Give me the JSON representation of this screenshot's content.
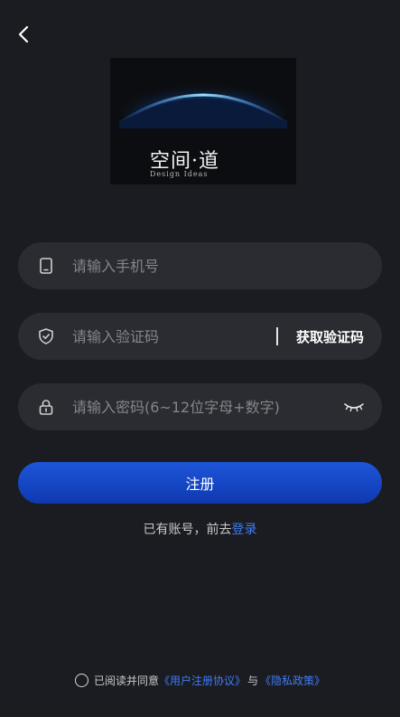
{
  "logo": {
    "text": "空间·道",
    "subtitle": "Design Ideas"
  },
  "icons": {
    "back": "chevron-left-icon",
    "phone": "phone-icon",
    "shield": "shield-check-icon",
    "lock": "lock-icon",
    "eye": "eye-closed-icon"
  },
  "form": {
    "phone_placeholder": "请输入手机号",
    "code_placeholder": "请输入验证码",
    "get_code_label": "获取验证码",
    "password_placeholder": "请输入密码(6~12位字母+数字)"
  },
  "register_button": "注册",
  "login_prompt": {
    "prefix": "已有账号，前去",
    "link": "登录"
  },
  "agreement": {
    "prefix": "已阅读并同意",
    "user_agreement": "《用户注册协议》",
    "connector": "与",
    "privacy_policy": "《隐私政策》"
  },
  "colors": {
    "background": "#1b1c21",
    "field_background": "#2b2c31",
    "accent": "#1d56d9",
    "link": "#3f7cf5"
  }
}
